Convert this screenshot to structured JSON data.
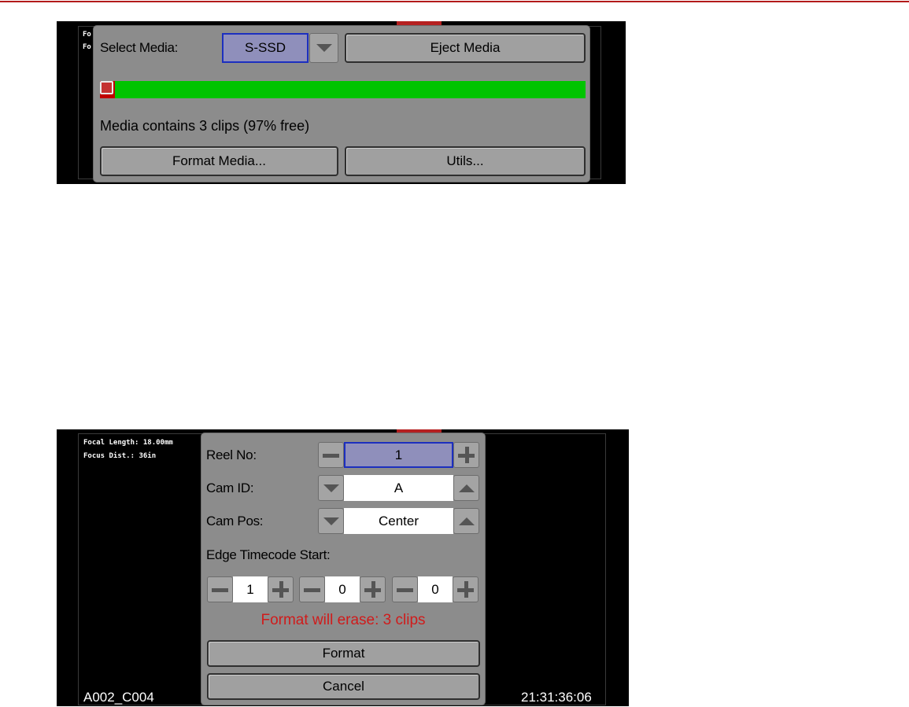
{
  "colors": {
    "accent_red": "#b31a1a",
    "selection_blue": "#1c2fbf",
    "progress_green": "#00c400",
    "warning_red": "#d01b1b"
  },
  "media_screen": {
    "overlay_text": [
      "Fo",
      "Fo"
    ],
    "select_media_label": "Select Media:",
    "selected_media": "S-SSD",
    "dropdown_icon": "chevron-down-icon",
    "eject_button": "Eject Media",
    "media_used_percent": 3,
    "status_text": "Media contains 3 clips (97% free)",
    "format_media_button": "Format Media...",
    "utils_button": "Utils..."
  },
  "format_screen": {
    "overlay": {
      "focal_length": "Focal Length: 18.00mm",
      "focus_dist": "Focus Dist.: 36in"
    },
    "clip_name": "A002_C004",
    "timecode": "21:31:36:06",
    "reel_label": "Reel No:",
    "reel_value": "1",
    "cam_id_label": "Cam ID:",
    "cam_id_value": "A",
    "cam_pos_label": "Cam Pos:",
    "cam_pos_value": "Center",
    "edge_tc_label": "Edge Timecode Start:",
    "edge_tc_values": [
      "1",
      "0",
      "0"
    ],
    "warning": "Format will erase: 3 clips",
    "format_button": "Format",
    "cancel_button": "Cancel"
  }
}
